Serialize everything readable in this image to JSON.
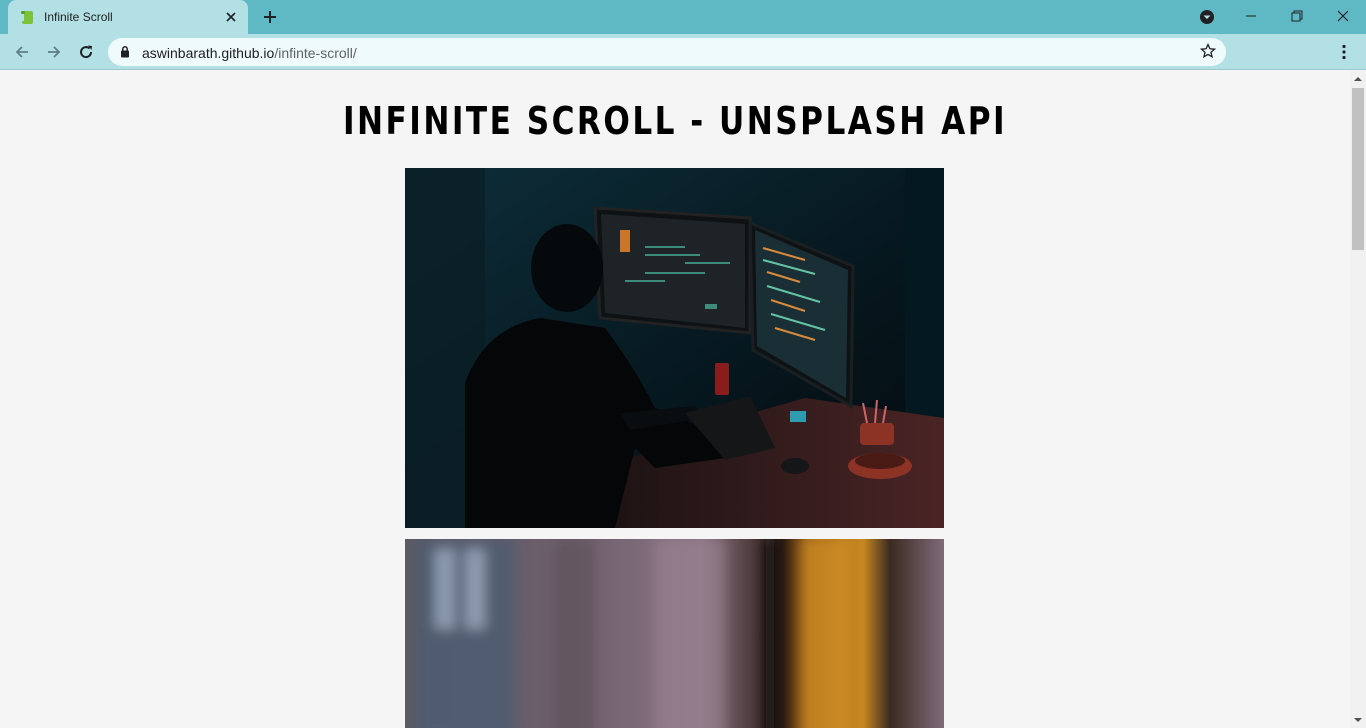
{
  "browser": {
    "tab": {
      "title": "Infinite Scroll",
      "favicon": "scroll-favicon-icon"
    },
    "address": {
      "host": "aswinbarath.github.io",
      "path": "/infinte-scroll/"
    },
    "colors": {
      "tabbar": "#5fb9c4",
      "toolbar": "#b2e0e5",
      "omnibox": "#effafb"
    }
  },
  "page": {
    "title": "INFINITE SCROLL - UNSPLASH API",
    "photos": [
      {
        "description": "person coding at desk with two monitors in dark room",
        "icon": "photo-icon"
      },
      {
        "description": "blurred window with warm orange light",
        "icon": "photo-icon"
      }
    ]
  }
}
